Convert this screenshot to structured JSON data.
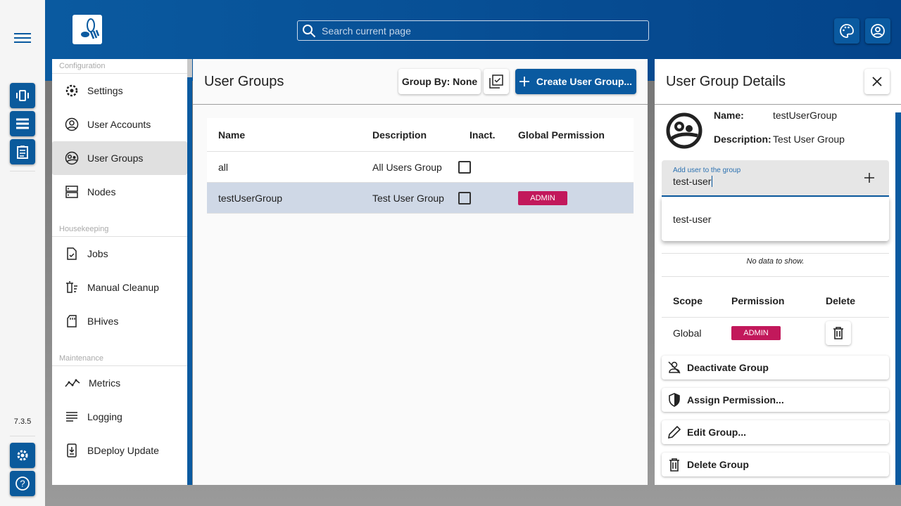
{
  "app": {
    "version": "7.3.5",
    "search_placeholder": "Search current page"
  },
  "sidebar": {
    "sections": [
      {
        "label": "Configuration",
        "items": [
          {
            "label": "Settings",
            "icon": "gear-icon"
          },
          {
            "label": "User Accounts",
            "icon": "account-circle-icon"
          },
          {
            "label": "User Groups",
            "icon": "group-icon",
            "selected": true
          },
          {
            "label": "Nodes",
            "icon": "server-icon"
          }
        ]
      },
      {
        "label": "Housekeeping",
        "items": [
          {
            "label": "Jobs",
            "icon": "task-file-icon"
          },
          {
            "label": "Manual Cleanup",
            "icon": "cleanup-icon"
          },
          {
            "label": "BHives",
            "icon": "sd-card-icon"
          }
        ]
      },
      {
        "label": "Maintenance",
        "items": [
          {
            "label": "Metrics",
            "icon": "metrics-icon"
          },
          {
            "label": "Logging",
            "icon": "logging-icon"
          },
          {
            "label": "BDeploy Update",
            "icon": "update-icon"
          }
        ]
      }
    ]
  },
  "main": {
    "title": "User Groups",
    "group_by": "Group By: None",
    "create": "Create User Group...",
    "columns": [
      "Name",
      "Description",
      "Inact.",
      "Global Permission"
    ],
    "rows": [
      {
        "name": "all",
        "description": "All Users Group",
        "inactive": false,
        "permission": ""
      },
      {
        "name": "testUserGroup",
        "description": "Test User Group",
        "inactive": false,
        "permission": "ADMIN",
        "selected": true
      }
    ]
  },
  "details": {
    "title": "User Group Details",
    "name_label": "Name:",
    "name": "testUserGroup",
    "desc_label": "Description:",
    "description": "Test User Group",
    "add_label": "Add user to the group",
    "add_value": "test-user",
    "suggestion": "test-user",
    "no_data": "No data to show.",
    "perm_columns": [
      "Scope",
      "Permission",
      "Delete"
    ],
    "perm_rows": [
      {
        "scope": "Global",
        "permission": "ADMIN"
      }
    ],
    "actions": [
      "Deactivate Group",
      "Assign Permission...",
      "Edit Group...",
      "Delete Group"
    ]
  },
  "colors": {
    "primary": "#0a5aa0",
    "admin": "#c2185b"
  }
}
